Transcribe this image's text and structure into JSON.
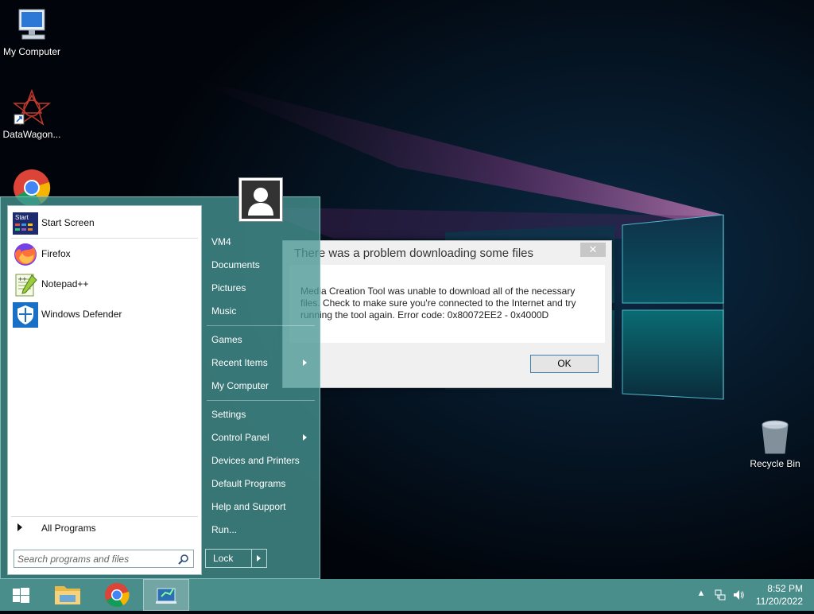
{
  "desktop": {
    "icons": [
      {
        "label": "My Computer"
      },
      {
        "label": "DataWagon..."
      },
      {
        "label": "Recycle Bin"
      }
    ]
  },
  "dialog": {
    "title": "There was a problem downloading some files",
    "message": "Media Creation Tool was unable to download all of the necessary files. Check to make sure you're connected to the Internet and try running the tool again. Error code: 0x80072EE2 - 0x4000D",
    "close_label": "✕",
    "ok_label": "OK"
  },
  "start_menu": {
    "pinned": [
      {
        "label": "Start Screen",
        "icon": "start-screen-icon"
      },
      {
        "label": "Firefox",
        "icon": "firefox-icon"
      },
      {
        "label": "Notepad++",
        "icon": "notepadpp-icon"
      },
      {
        "label": "Windows Defender",
        "icon": "windows-defender-icon"
      }
    ],
    "all_programs_label": "All Programs",
    "search_placeholder": "Search programs and files",
    "right_items": [
      {
        "label": "VM4"
      },
      {
        "label": "Documents"
      },
      {
        "label": "Pictures"
      },
      {
        "label": "Music"
      },
      {
        "label": "Games"
      },
      {
        "label": "Recent Items",
        "submenu": true
      },
      {
        "label": "My Computer"
      },
      {
        "label": "Settings"
      },
      {
        "label": "Control Panel",
        "submenu": true
      },
      {
        "label": "Devices and Printers"
      },
      {
        "label": "Default Programs"
      },
      {
        "label": "Help and Support"
      },
      {
        "label": "Run..."
      }
    ],
    "lock_label": "Lock"
  },
  "taskbar": {
    "buttons": [
      {
        "name": "start-button",
        "icon": "windows-logo-icon"
      },
      {
        "name": "file-explorer",
        "icon": "folder-icon"
      },
      {
        "name": "chrome",
        "icon": "chrome-icon"
      },
      {
        "name": "media-creation-tool",
        "icon": "media-tool-icon",
        "active": true
      }
    ],
    "time": "8:52 PM",
    "date": "11/20/2022"
  },
  "colors": {
    "start_menu_bg": "#4a9694",
    "taskbar_bg": "#4a8e8c",
    "dialog_button_border": "#3c7fb1"
  }
}
